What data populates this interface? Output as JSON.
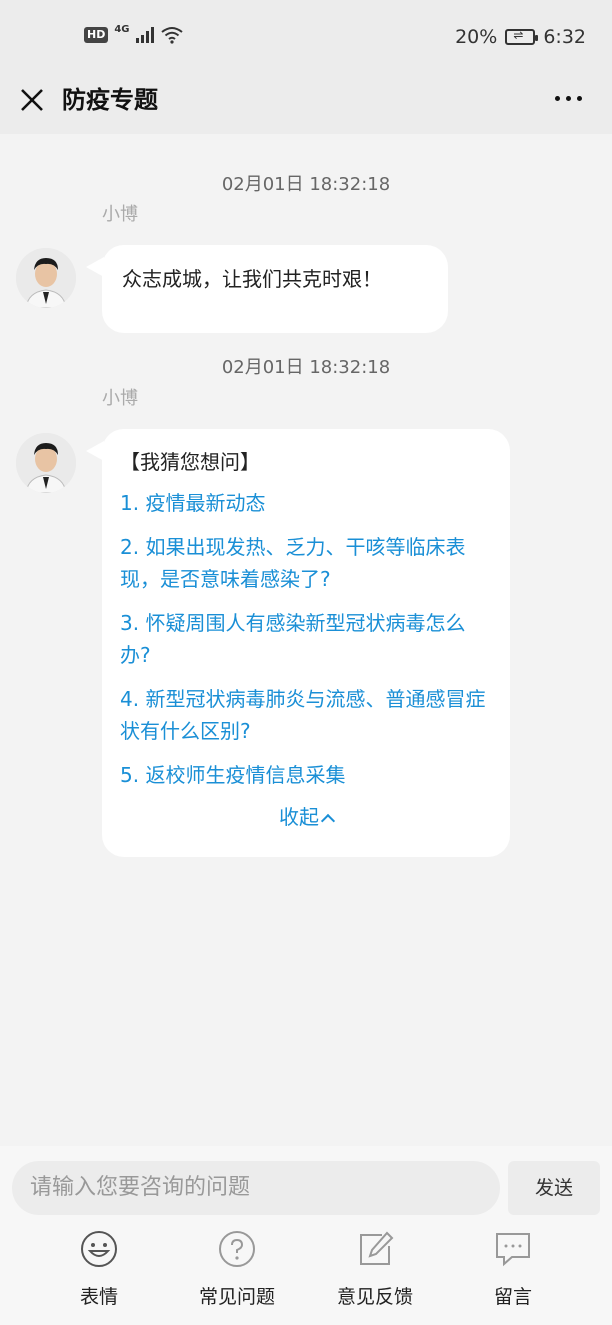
{
  "status_bar": {
    "network_badge": "HD",
    "network_type": "4G",
    "battery_percent": "20%",
    "time": "6:32"
  },
  "header": {
    "title": "防疫专题"
  },
  "messages": [
    {
      "timestamp": "02月01日 18:32:18",
      "sender": "小博",
      "text": "众志成城，让我们共克时艰！"
    },
    {
      "timestamp": "02月01日 18:32:18",
      "sender": "小博",
      "heading": "【我猜您想问】",
      "questions": [
        "1. 疫情最新动态",
        "2. 如果出现发热、乏力、干咳等临床表现，是否意味着感染了?",
        "3. 怀疑周围人有感染新型冠状病毒怎么办?",
        "4. 新型冠状病毒肺炎与流感、普通感冒症状有什么区别?",
        "5. 返校师生疫情信息采集"
      ],
      "collapse_label": "收起"
    }
  ],
  "composer": {
    "placeholder": "请输入您要咨询的问题",
    "send_label": "发送"
  },
  "toolbar": [
    {
      "label": "表情",
      "icon": "emoji-icon"
    },
    {
      "label": "常见问题",
      "icon": "question-icon"
    },
    {
      "label": "意见反馈",
      "icon": "edit-icon"
    },
    {
      "label": "留言",
      "icon": "message-icon"
    }
  ],
  "colors": {
    "link": "#1a8fd6",
    "background": "#f3f3f3",
    "bar": "#ececec"
  }
}
